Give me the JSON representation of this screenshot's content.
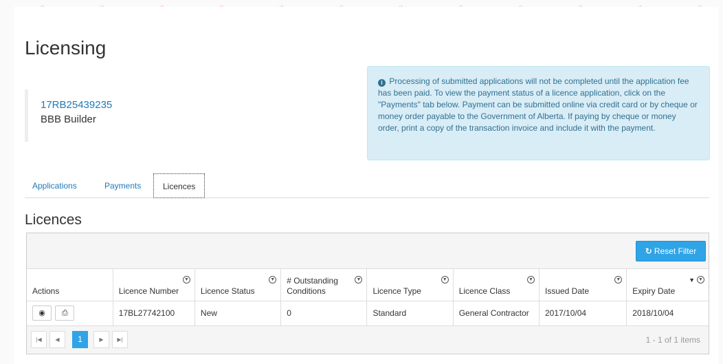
{
  "page": {
    "title": "Licensing"
  },
  "account": {
    "number": "17RB25439235",
    "name": "BBB Builder"
  },
  "info_message": "Processing of submitted applications will not be completed until the application fee has been paid. To view the payment status of a licence application, click on the \"Payments\" tab below. Payment can be submitted online via credit card or by cheque or money order payable to the Government of Alberta. If paying by cheque or money order, print a copy of the transaction invoice and include it with the payment.",
  "tabs": [
    {
      "label": "Applications"
    },
    {
      "label": "Payments"
    },
    {
      "label": "Licences",
      "active": true
    }
  ],
  "section": {
    "title": "Licences"
  },
  "toolbar": {
    "reset_filter_label": "Reset Filter"
  },
  "table": {
    "columns": [
      {
        "label": "Actions"
      },
      {
        "label": "Licence Number"
      },
      {
        "label": "Licence Status"
      },
      {
        "label": "# Outstanding Conditions"
      },
      {
        "label": "Licence Type"
      },
      {
        "label": "Licence Class"
      },
      {
        "label": "Issued Date"
      },
      {
        "label": "Expiry Date"
      }
    ],
    "rows": [
      {
        "licence_number": "17BL27742100",
        "status": "New",
        "outstanding_conditions": "0",
        "type": "Standard",
        "class": "General Contractor",
        "issued_date": "2017/10/04",
        "expiry_date": "2018/10/04"
      }
    ]
  },
  "pager": {
    "current_page": "1",
    "summary": "1 - 1 of 1 items"
  },
  "colors": {
    "accent": "#2fa4e7",
    "link": "#1e7ab8",
    "info_bg": "#d9edf7",
    "info_text": "#31708f"
  }
}
